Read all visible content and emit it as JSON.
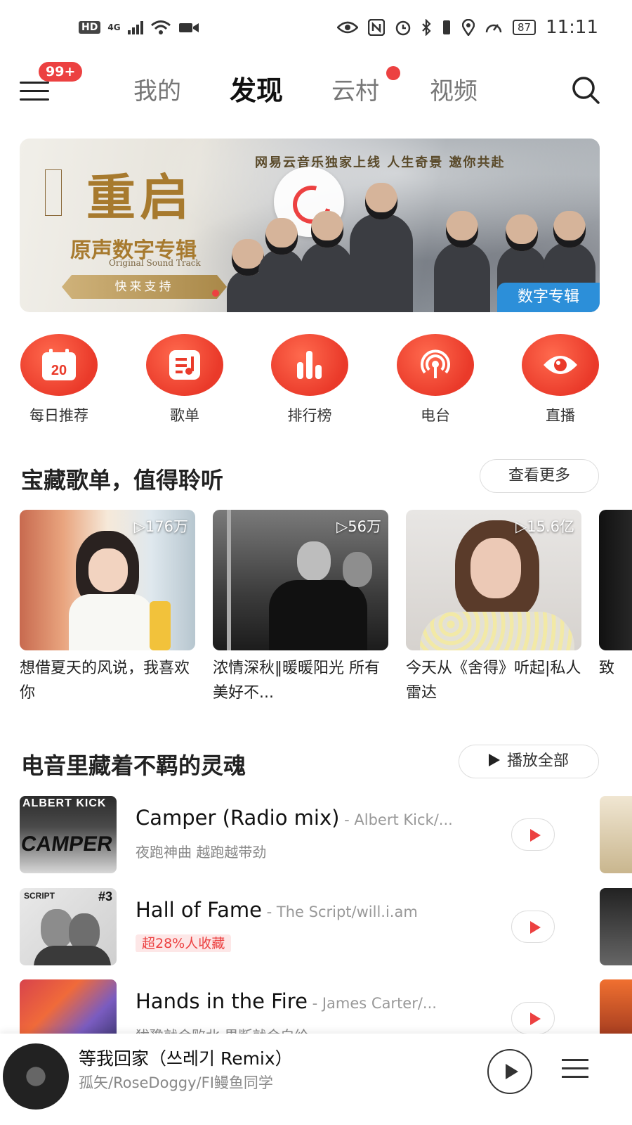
{
  "status_bar": {
    "hd": "HD",
    "network": "4G",
    "battery": "87",
    "time": "11:11"
  },
  "top_nav": {
    "menu_badge": "99+",
    "tabs": [
      {
        "label": "我的"
      },
      {
        "label": "发现"
      },
      {
        "label": "云村"
      },
      {
        "label": "视频"
      }
    ],
    "active_tab": "发现"
  },
  "banner": {
    "topline": "网易云音乐独家上线 人生奇景 邀你共赴",
    "calligraphy": "重启",
    "subtitle": "原声数字专辑",
    "ost": "Original Sound Track",
    "cta": "快来支持",
    "tag": "数字专辑"
  },
  "quick_entries": [
    {
      "label": "每日推荐",
      "icon": "calendar-icon",
      "day": "20"
    },
    {
      "label": "歌单",
      "icon": "playlist-icon"
    },
    {
      "label": "排行榜",
      "icon": "chart-icon"
    },
    {
      "label": "电台",
      "icon": "radio-icon"
    },
    {
      "label": "直播",
      "icon": "live-icon"
    }
  ],
  "playlists_section": {
    "title": "宝藏歌单，值得聆听",
    "more": "查看更多",
    "items": [
      {
        "count": "▷176万",
        "title": "想借夏天的风说，我喜欢你"
      },
      {
        "count": "▷56万",
        "title": "浓情深秋‖暖暖阳光 所有美好不..."
      },
      {
        "count": "▷15.6亿",
        "title": "今天从《舍得》听起|私人雷达"
      },
      {
        "title": "致"
      }
    ]
  },
  "songs_section": {
    "title": "电音里藏着不羁的灵魂",
    "play_all": "播放全部",
    "items": [
      {
        "name": "Camper (Radio mix)",
        "artist": " - Albert Kick/...",
        "sub": "夜跑神曲 越跑越带劲",
        "tag": "",
        "cover_text": "ALBERT KICK",
        "cover_text2": "CAMPER"
      },
      {
        "name": "Hall of Fame",
        "artist": " - The Script/will.i.am",
        "sub": "",
        "tag": "超28%人收藏",
        "cover_text": "SCRIPT",
        "cover_text2": "#3"
      },
      {
        "name": "Hands in the Fire",
        "artist": " - James Carter/...",
        "sub": "犹豫就会败北 果断就会白给",
        "tag": "",
        "cover_text": "",
        "cover_text2": ""
      }
    ]
  },
  "mini_player": {
    "title": "等我回家（쓰레기 Remix）",
    "artist": "孤矢/RoseDoggy/FI鳗鱼同学"
  },
  "colors": {
    "accent": "#ec4141",
    "tag_blue": "#2c8fd9"
  }
}
